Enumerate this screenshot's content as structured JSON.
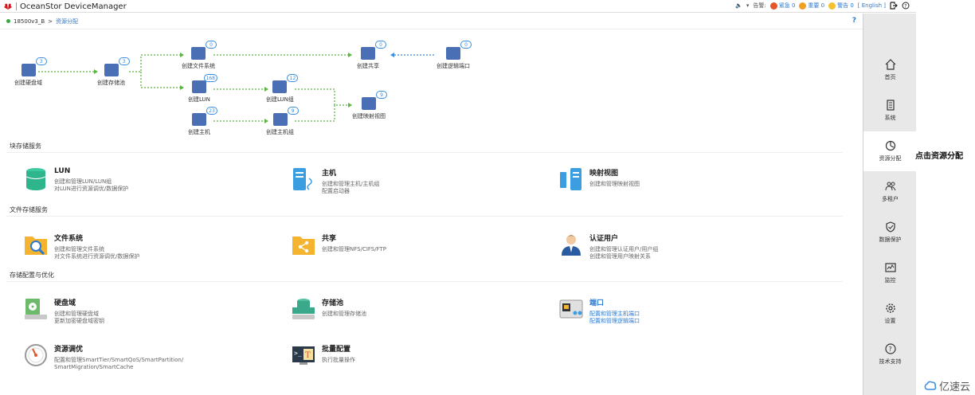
{
  "app": {
    "title": "OceanStor DeviceManager",
    "volume_label": "▾",
    "alarm_label": "告警:",
    "urgent": "紧急 0",
    "major": "重要 0",
    "warning": "警告 0",
    "lang": "[ English ]",
    "colors": {
      "urgent": "#e5542a",
      "major": "#f0a020",
      "warning": "#f2c230",
      "accent": "#2a7ad2"
    }
  },
  "breadcrumb": {
    "device": "18500v3_B",
    "sep": ">",
    "current": "资源分配",
    "help": "?"
  },
  "flow": {
    "disk_domain": {
      "label": "创建硬盘域",
      "count": "3"
    },
    "pool": {
      "label": "创建存储池",
      "count": "3"
    },
    "fs": {
      "label": "创建文件系统",
      "count": "0"
    },
    "share": {
      "label": "创建共享",
      "count": "0"
    },
    "logical_port": {
      "label": "创建逻辑端口",
      "count": "0"
    },
    "lun": {
      "label": "创建LUN",
      "count": "168"
    },
    "lun_group": {
      "label": "创建LUN组",
      "count": "12"
    },
    "mapping": {
      "label": "创建映射视图",
      "count": "9"
    },
    "host": {
      "label": "创建主机",
      "count": "23"
    },
    "host_group": {
      "label": "创建主机组",
      "count": "9"
    }
  },
  "sections": {
    "block": "块存储服务",
    "file": "文件存储服务",
    "config": "存储配置与优化"
  },
  "cards": {
    "lun": {
      "title": "LUN",
      "d1": "创建和管理LUN/LUN组",
      "d2": "对LUN进行资源调优/数据保护"
    },
    "host": {
      "title": "主机",
      "d1": "创建和管理主机/主机组",
      "d2": "配置启动器"
    },
    "mapping": {
      "title": "映射视图",
      "d1": "创建和管理映射视图"
    },
    "fs": {
      "title": "文件系统",
      "d1": "创建和管理文件系统",
      "d2": "对文件系统进行资源调优/数据保护"
    },
    "share": {
      "title": "共享",
      "d1": "创建和管理NFS/CIFS/FTP"
    },
    "auth": {
      "title": "认证用户",
      "d1": "创建和管理认证用户/用户组",
      "d2": "创建和管理用户映射关系"
    },
    "diskdomain": {
      "title": "硬盘域",
      "d1": "创建和管理硬盘域",
      "d2": "更新加密硬盘域密钥"
    },
    "pool": {
      "title": "存储池",
      "d1": "创建和管理存储池"
    },
    "port": {
      "title": "端口",
      "d1": "配置和管理主机端口",
      "d2": "配置和管理逻辑端口"
    },
    "tuning": {
      "title": "资源调优",
      "d1": "配置和管理SmartTier/SmartQoS/SmartPartition/",
      "d2": "SmartMigration/SmartCache"
    },
    "batch": {
      "title": "批量配置",
      "d1": "执行批量操作"
    }
  },
  "sidebar": {
    "home": "首页",
    "system": "系统",
    "resource": "资源分配",
    "tenant": "多租户",
    "protect": "数据保护",
    "monitor": "监控",
    "settings": "设置",
    "support": "技术支持"
  },
  "hint": "点击资源分配",
  "watermark": "亿速云"
}
